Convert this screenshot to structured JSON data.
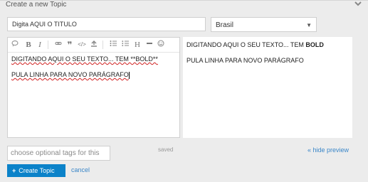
{
  "header": {
    "title": "Create a new Topic",
    "collapse_icon": "chevron-down-icon"
  },
  "title_field": {
    "value": "Digita AQUI O TITULO"
  },
  "category": {
    "selected": "Brasil"
  },
  "toolbar": {
    "buttons": [
      "speech-bubble-icon",
      "bold-icon",
      "italic-icon",
      "link-icon",
      "quote-icon",
      "code-icon",
      "upload-icon",
      "bullet-list-icon",
      "numbered-list-icon",
      "heading-icon",
      "horizontal-rule-icon",
      "emoji-icon"
    ]
  },
  "editor": {
    "line1": "DIGITANDO AQUI O SEU TEXTO... TEM **BOLD**",
    "line2": "PULA LINHA PARA NOVO PARÁGRAFO"
  },
  "preview": {
    "line1_normal": "DIGITANDO AQUI O SEU TEXTO... TEM ",
    "line1_bold": "BOLD",
    "line2": "PULA LINHA PARA NOVO PARÁGRAFO"
  },
  "tags": {
    "placeholder": "choose optional tags for this"
  },
  "status": {
    "saved": "saved"
  },
  "links": {
    "hide_preview": "« hide preview",
    "cancel": "cancel"
  },
  "actions": {
    "create_label": "Create Topic"
  },
  "colors": {
    "primary": "#0b82c9",
    "link": "#3a86c8",
    "panel_bg": "#ececec"
  }
}
